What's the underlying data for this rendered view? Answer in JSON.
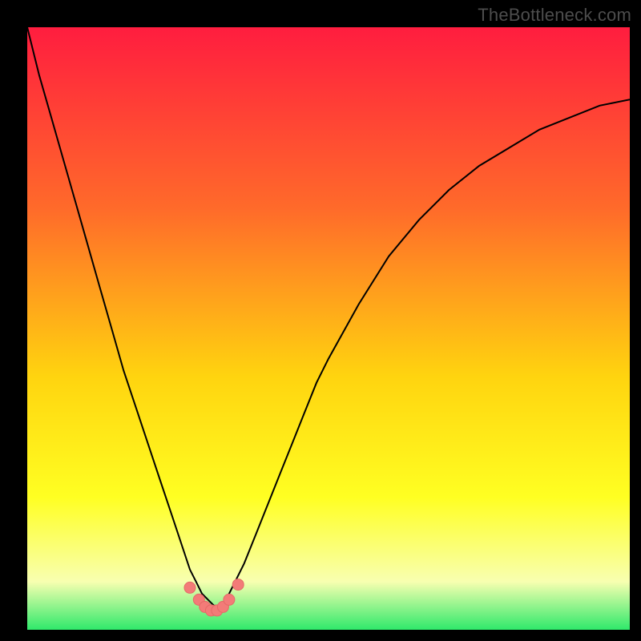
{
  "watermark": "TheBottleneck.com",
  "colors": {
    "frame": "#000000",
    "gradient_top": "#ff1d3f",
    "gradient_mid1": "#ff6a2a",
    "gradient_mid2": "#ffd40f",
    "gradient_yellow": "#ffff22",
    "gradient_pale": "#f8ffb0",
    "gradient_green": "#2fe96b",
    "curve": "#000000",
    "marker_fill": "#f37b78",
    "marker_stroke": "#e46a67"
  },
  "chart_data": {
    "type": "line",
    "title": "",
    "xlabel": "",
    "ylabel": "",
    "xlim": [
      0,
      100
    ],
    "ylim": [
      0,
      100
    ],
    "series": [
      {
        "name": "bottleneck-curve",
        "x": [
          0,
          2,
          4,
          6,
          8,
          10,
          12,
          14,
          16,
          18,
          20,
          22,
          24,
          26,
          27,
          28,
          29,
          30,
          31,
          32,
          33,
          34,
          36,
          38,
          40,
          42,
          44,
          46,
          48,
          50,
          55,
          60,
          65,
          70,
          75,
          80,
          85,
          90,
          95,
          100
        ],
        "y": [
          100,
          92,
          85,
          78,
          71,
          64,
          57,
          50,
          43,
          37,
          31,
          25,
          19,
          13,
          10,
          8,
          6,
          5,
          4,
          4,
          5,
          7,
          11,
          16,
          21,
          26,
          31,
          36,
          41,
          45,
          54,
          62,
          68,
          73,
          77,
          80,
          83,
          85,
          87,
          88
        ]
      }
    ],
    "markers": {
      "name": "highlighted-points",
      "x": [
        27,
        28.5,
        29.5,
        30.5,
        31.5,
        32.5,
        33.5,
        35
      ],
      "y": [
        7.0,
        5.0,
        3.8,
        3.2,
        3.2,
        3.8,
        5.0,
        7.5
      ]
    }
  }
}
